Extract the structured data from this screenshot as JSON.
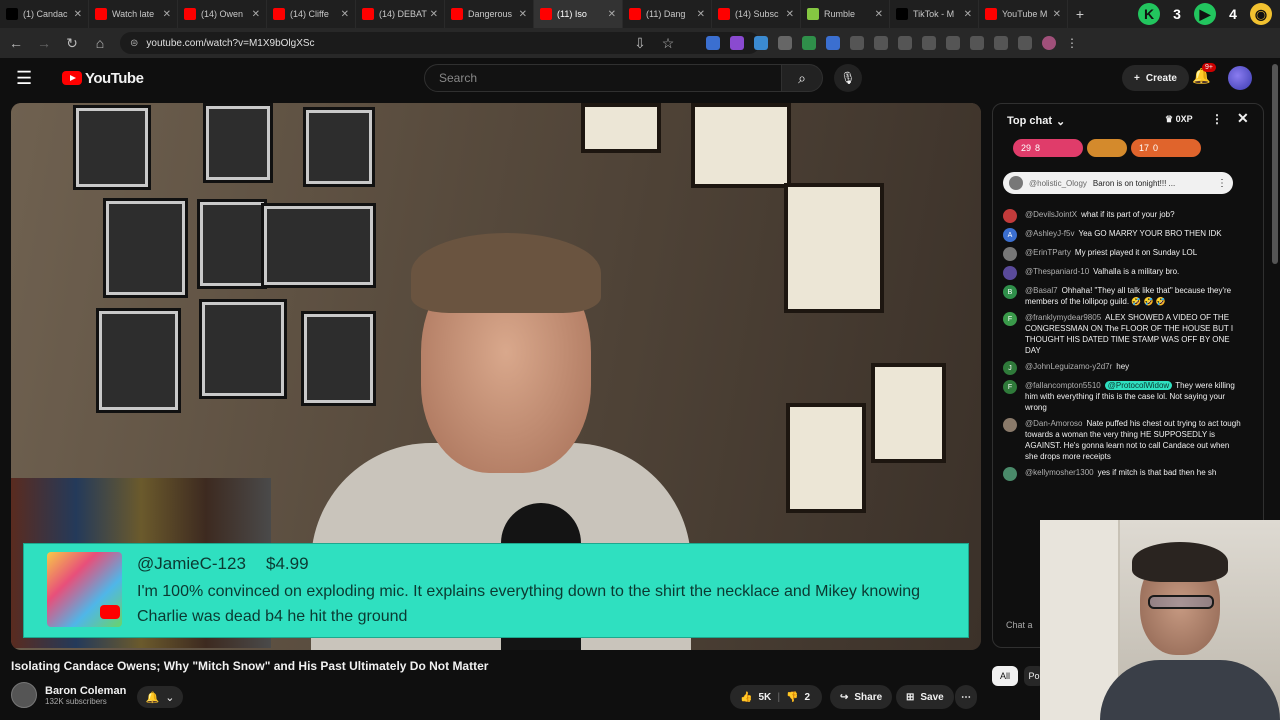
{
  "browser": {
    "tabs": [
      {
        "title": "(1) Candac",
        "icon": "x-icon",
        "color": "#000000"
      },
      {
        "title": "Watch late",
        "icon": "youtube-icon",
        "color": "#ff0000"
      },
      {
        "title": "(14) Owen",
        "icon": "youtube-icon",
        "color": "#ff0000"
      },
      {
        "title": "(14) Cliffe",
        "icon": "youtube-icon",
        "color": "#ff0000"
      },
      {
        "title": "(14) DEBAT",
        "icon": "youtube-icon",
        "color": "#ff0000"
      },
      {
        "title": "Dangerous",
        "icon": "youtube-icon",
        "color": "#ff0000"
      },
      {
        "title": "(11) Iso",
        "icon": "youtube-icon",
        "color": "#ff0000"
      },
      {
        "title": "(11) Dang",
        "icon": "youtube-icon",
        "color": "#ff0000"
      },
      {
        "title": "(14) Subsc",
        "icon": "youtube-icon",
        "color": "#ff0000"
      },
      {
        "title": "Rumble",
        "icon": "rumble-icon",
        "color": "#85c742"
      },
      {
        "title": "TikTok - M",
        "icon": "tiktok-icon",
        "color": "#000000"
      },
      {
        "title": "YouTube M",
        "icon": "youtube-icon",
        "color": "#ff0000"
      }
    ],
    "ext_badges": [
      "3",
      "4"
    ],
    "url": "youtube.com/watch?v=M1X9bOlgXSc"
  },
  "header": {
    "logo_text": "YouTube",
    "search_placeholder": "Search",
    "create_label": "Create",
    "notif_count": "9+"
  },
  "video": {
    "superchat": {
      "name": "@JamieC-123",
      "amount": "$4.99",
      "message": "I'm 100% convinced on exploding mic. It explains everything down to the shirt the necklace and Mikey knowing Charlie was dead b4 he hit the ground"
    },
    "title": "Isolating Candace Owens; Why \"Mitch Snow\" and His Past Ultimately Do Not Matter",
    "channel": "Baron Coleman",
    "subscribers": "132K subscribers",
    "likes": "5K",
    "dislikes": "2",
    "share_label": "Share",
    "save_label": "Save"
  },
  "chat": {
    "title": "Top chat",
    "points": "0XP",
    "pills": [
      {
        "a": "29",
        "b": "8",
        "color": "#e03c6a"
      },
      {
        "a": "",
        "b": "",
        "color": "#d48a2c"
      },
      {
        "a": "17",
        "b": "0",
        "color": "#e0642c"
      }
    ],
    "pinned": {
      "author": "@holistic_Ology",
      "text": "Baron is on tonight!!! ..."
    },
    "messages": [
      {
        "author": "@DevilsJointX",
        "text": "what if its part of your job?",
        "avatar": "",
        "color": "#c23b3b"
      },
      {
        "author": "@AshleyJ-f5v",
        "text": "Yea GO MARRY YOUR BRO THEN IDK",
        "avatar": "A",
        "color": "#3b6fd0"
      },
      {
        "author": "@ErinTParty",
        "text": "My priest played it on Sunday LOL",
        "avatar": "",
        "color": "#777777"
      },
      {
        "author": "@Thespaniard-10",
        "text": "Valhalla is a military bro.",
        "avatar": "",
        "color": "#5a4a9a"
      },
      {
        "author": "@Basal7",
        "text": "Ohhaha! \"They all talk like that\" because they're members of the lollipop guild. 🤣 🤣 🤣",
        "avatar": "B",
        "color": "#2f8f4a"
      },
      {
        "author": "@franklymydear9805",
        "text": "ALEX SHOWED A VIDEO OF THE CONGRESSMAN ON The FLOOR OF THE HOUSE BUT I THOUGHT HIS DATED TIME STAMP WAS OFF BY ONE DAY",
        "avatar": "F",
        "color": "#3a9a4a"
      },
      {
        "author": "@JohnLeguizamo-y2d7r",
        "text": "hey",
        "avatar": "J",
        "color": "#2f7a3a"
      },
      {
        "author": "@fallancompton5510",
        "text": "They were killing him with everything if this is the case lol. Not saying your wrong",
        "tag": "@ProtocolWidow",
        "avatar": "F",
        "color": "#2f7a3a"
      },
      {
        "author": "@Dan-Amoroso",
        "text": "Nate puffed his chest out trying to act tough towards a woman the very thing HE SUPPOSEDLY is AGAINST. He's gonna learn not to call Candace out when she drops more receipts",
        "avatar": "",
        "color": "#8a7a6a"
      },
      {
        "author": "@kellymosher1300",
        "text": "yes if mitch is that bad then he sh",
        "avatar": "",
        "color": "#4a8a6a"
      }
    ],
    "input_placeholder": "Chat a",
    "chip_all": "All",
    "chip_po": "Po"
  }
}
